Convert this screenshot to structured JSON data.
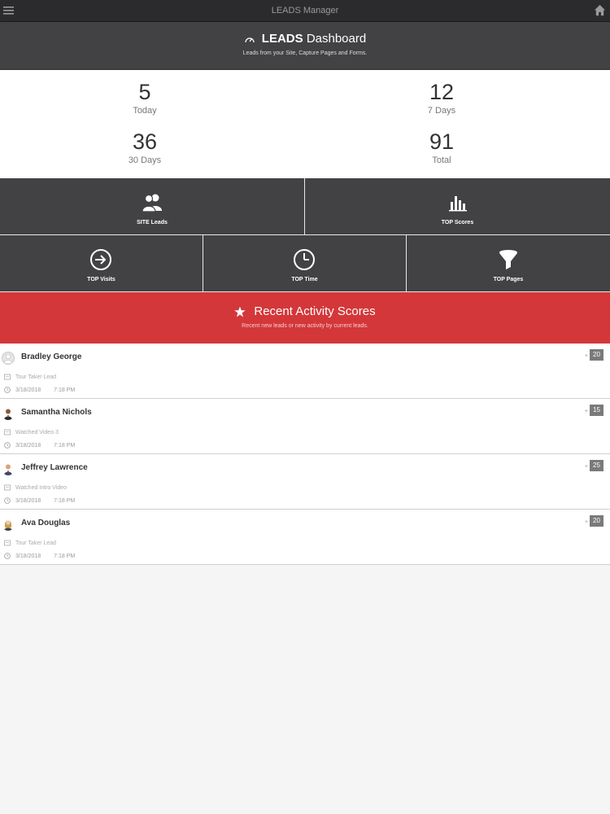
{
  "app": {
    "title": "LEADS Manager"
  },
  "dashboard": {
    "title_bold": "LEADS",
    "title_rest": "Dashboard",
    "subtitle": "Leads from your Site, Capture Pages and Forms."
  },
  "stats": [
    {
      "value": "5",
      "label": "Today"
    },
    {
      "value": "12",
      "label": "7 Days"
    },
    {
      "value": "36",
      "label": "30 Days"
    },
    {
      "value": "91",
      "label": "Total"
    }
  ],
  "tiles": {
    "site_leads": "SITE Leads",
    "top_scores": "TOP Scores",
    "top_visits": "TOP Visits",
    "top_time": "TOP Time",
    "top_pages": "TOP Pages"
  },
  "recent": {
    "title": "Recent Activity Scores",
    "subtitle": "Recent new leads or new activity by current leads."
  },
  "activities": [
    {
      "name": "Bradley George",
      "action": "Tour Taker Lead",
      "date": "3/18/2018",
      "time": "7:18 PM",
      "plus": "+",
      "score": "20"
    },
    {
      "name": "Samantha Nichols",
      "action": "Watched Video 3",
      "date": "3/18/2018",
      "time": "7:18 PM",
      "plus": "+",
      "score": "15"
    },
    {
      "name": "Jeffrey Lawrence",
      "action": "Watched Intro Video",
      "date": "3/18/2018",
      "time": "7:18 PM",
      "plus": "+",
      "score": "25"
    },
    {
      "name": "Ava Douglas",
      "action": "Tour Taker Lead",
      "date": "3/18/2018",
      "time": "7:18 PM",
      "plus": "+",
      "score": "20"
    }
  ],
  "colors": {
    "accent": "#d3373a",
    "dark": "#424244",
    "topbar": "#2b2b2d"
  }
}
